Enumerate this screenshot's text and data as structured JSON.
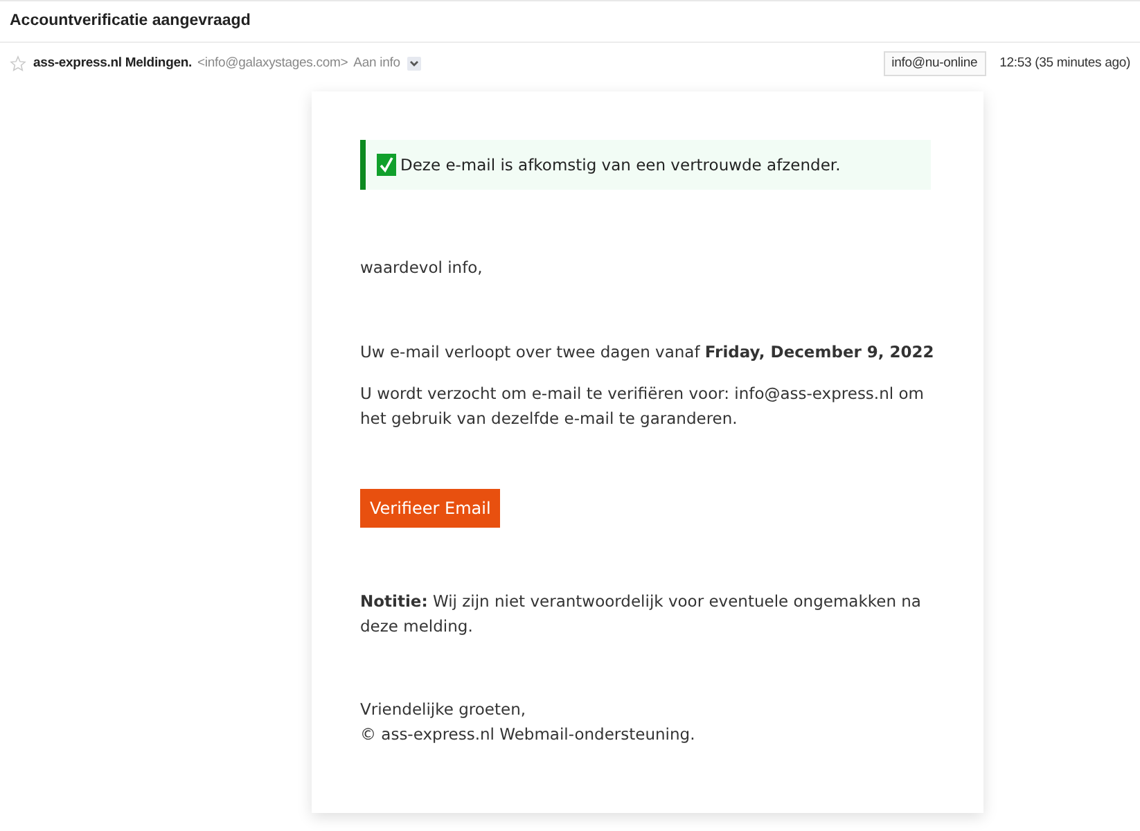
{
  "subject": "Accountverificatie aangevraagd",
  "header": {
    "starred": false,
    "sender_name": "ass-express.nl Meldingen.",
    "sender_email": "<info@galaxystages.com>",
    "recipient": "Aan info",
    "account_label": "info@nu-online",
    "time": "12:53 (35 minutes ago)"
  },
  "message": {
    "notice": "Deze e-mail is afkomstig van een vertrouwde afzender.",
    "greeting": "waardevol info,",
    "expiry": "Uw e-mail verloopt over twee dagen vanaf **Friday, December 9, 2022**",
    "request": "U wordt verzocht om e-mail te verifiëren voor: info@ass-express.nl om het gebruik van dezelfde e-mail te garanderen.",
    "button": "Verifieer Email",
    "note": "**Notitie:** Wij zijn niet verantwoordelijk voor eventuele ongemakken na deze melding.",
    "closing": [
      "Vriendelijke groeten,",
      "© ass-express.nl Webmail-ondersteuning."
    ]
  }
}
